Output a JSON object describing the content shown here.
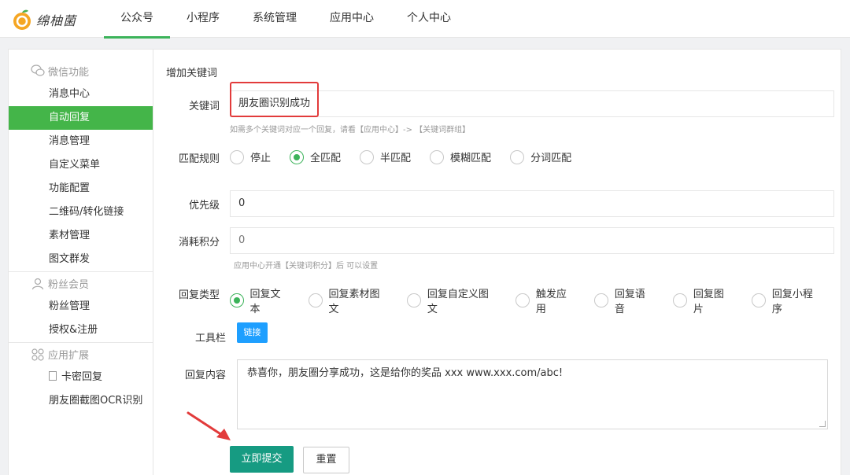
{
  "logo": {
    "text": "绵柚菌"
  },
  "nav": [
    "公众号",
    "小程序",
    "系统管理",
    "应用中心",
    "个人中心"
  ],
  "sidebar": {
    "group1": "微信功能",
    "group1_items": [
      "消息中心",
      "自动回复",
      "消息管理",
      "自定义菜单",
      "功能配置",
      "二维码/转化链接",
      "素材管理",
      "图文群发"
    ],
    "group2": "粉丝会员",
    "group2_items": [
      "粉丝管理",
      "授权&注册"
    ],
    "group3": "应用扩展",
    "group3_items": [
      "卡密回复",
      "朋友圈截图OCR识别"
    ]
  },
  "form": {
    "title": "增加关键词",
    "keyword_label": "关键词",
    "keyword_value": "朋友圈识别成功",
    "keyword_hint": "如需多个关键词对应一个回复，请看【应用中心】-> 【关键词群组】",
    "match_label": "匹配规则",
    "match_options": [
      "停止",
      "全匹配",
      "半匹配",
      "模糊匹配",
      "分词匹配"
    ],
    "priority_label": "优先级",
    "priority_value": "0",
    "points_label": "消耗积分",
    "points_placeholder": "0",
    "points_hint": "应用中心开通【关键词积分】后 可以设置",
    "reply_type_label": "回复类型",
    "reply_type_options": [
      "回复文本",
      "回复素材图文",
      "回复自定义图文",
      "触发应用",
      "回复语音",
      "回复图片",
      "回复小程序"
    ],
    "toolbar_label": "工具栏",
    "link_button": "链接",
    "content_label": "回复内容",
    "content_value": "恭喜你，朋友圈分享成功，这是给你的奖品 xxx www.xxx.com/abc!",
    "submit_button": "立即提交",
    "reset_button": "重置"
  },
  "colors": {
    "accent": "#44b549",
    "submit": "#169b82",
    "link_button": "#1e9fff",
    "annotation": "#e23b3b"
  }
}
